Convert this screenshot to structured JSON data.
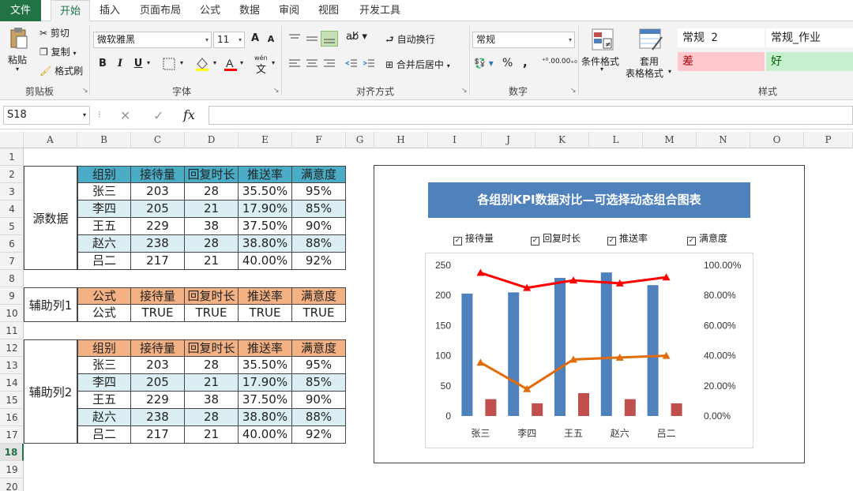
{
  "tabs": [
    "文件",
    "开始",
    "插入",
    "页面布局",
    "公式",
    "数据",
    "审阅",
    "视图",
    "开发工具"
  ],
  "ribbon": {
    "clipboard": {
      "paste": "粘贴",
      "cut": "剪切",
      "copy": "复制",
      "format_painter": "格式刷",
      "label": "剪贴板"
    },
    "font": {
      "name": "微软雅黑",
      "size": "11",
      "bold": "B",
      "italic": "I",
      "underline": "U",
      "label": "字体",
      "grow": "A",
      "shrink": "A",
      "wen": "wén",
      "wen_char": "文"
    },
    "align": {
      "wrap": "自动换行",
      "merge": "合并后居中",
      "label": "对齐方式"
    },
    "number": {
      "format": "常规",
      "percent": "%",
      "comma": ",",
      "inc": "⁺⁰.00",
      "dec": ".00₊₀",
      "label": "数字"
    },
    "styles": {
      "cond": "条件格式",
      "table_fmt_1": "套用",
      "table_fmt_2": "表格格式",
      "normal2": "常规 2",
      "normal_work": "常规_作业",
      "bad": "差",
      "good": "好",
      "label": "样式"
    }
  },
  "formula_bar": {
    "name_box": "S18",
    "fx": "fx",
    "cancel": "✕",
    "enter": "✓",
    "value": ""
  },
  "columns": [
    "A",
    "B",
    "C",
    "D",
    "E",
    "F",
    "G",
    "H",
    "I",
    "J",
    "K",
    "L",
    "M",
    "N",
    "O",
    "P"
  ],
  "rows": [
    "1",
    "2",
    "3",
    "4",
    "5",
    "6",
    "7",
    "8",
    "9",
    "10",
    "11",
    "12",
    "13",
    "14",
    "15",
    "16",
    "17",
    "18",
    "19",
    "20"
  ],
  "selected_row": "18",
  "blocks": {
    "source": {
      "label": "源数据",
      "header": [
        "组别",
        "接待量",
        "回复时长",
        "推送率",
        "满意度"
      ],
      "rows": [
        [
          "张三",
          "203",
          "28",
          "35.50%",
          "95%"
        ],
        [
          "李四",
          "205",
          "21",
          "17.90%",
          "85%"
        ],
        [
          "王五",
          "229",
          "38",
          "37.50%",
          "90%"
        ],
        [
          "赵六",
          "238",
          "28",
          "38.80%",
          "88%"
        ],
        [
          "吕二",
          "217",
          "21",
          "40.00%",
          "92%"
        ]
      ]
    },
    "helper1": {
      "label": "辅助列1",
      "header": [
        "公式",
        "接待量",
        "回复时长",
        "推送率",
        "满意度"
      ],
      "rows": [
        [
          "公式",
          "TRUE",
          "TRUE",
          "TRUE",
          "TRUE"
        ]
      ]
    },
    "helper2": {
      "label": "辅助列2",
      "header": [
        "组别",
        "接待量",
        "回复时长",
        "推送率",
        "满意度"
      ],
      "rows": [
        [
          "张三",
          "203",
          "28",
          "35.50%",
          "95%"
        ],
        [
          "李四",
          "205",
          "21",
          "17.90%",
          "85%"
        ],
        [
          "王五",
          "229",
          "38",
          "37.50%",
          "90%"
        ],
        [
          "赵六",
          "238",
          "28",
          "38.80%",
          "88%"
        ],
        [
          "吕二",
          "217",
          "21",
          "40.00%",
          "92%"
        ]
      ]
    }
  },
  "checkboxes": [
    {
      "label": "接待量",
      "checked": true
    },
    {
      "label": "回复时长",
      "checked": true
    },
    {
      "label": "推送率",
      "checked": true
    },
    {
      "label": "满意度",
      "checked": true
    }
  ],
  "colors": {
    "bar1": "#4f81bd",
    "bar2": "#c0504d",
    "line1": "#e26b0a",
    "line2": "#ff0000",
    "accent": "#217346",
    "title_bg": "#4f81bd"
  },
  "chart_data": {
    "type": "bar",
    "title": "各组别KPI数据对比—可选择动态组合图表",
    "categories": [
      "张三",
      "李四",
      "王五",
      "赵六",
      "吕二"
    ],
    "series": [
      {
        "name": "接待量",
        "type": "bar",
        "axis": "left",
        "values": [
          203,
          205,
          229,
          238,
          217
        ]
      },
      {
        "name": "回复时长",
        "type": "bar",
        "axis": "left",
        "values": [
          28,
          21,
          38,
          28,
          21
        ]
      },
      {
        "name": "推送率",
        "type": "line",
        "axis": "right",
        "values": [
          0.355,
          0.179,
          0.375,
          0.388,
          0.4
        ]
      },
      {
        "name": "满意度",
        "type": "line",
        "axis": "right",
        "values": [
          0.95,
          0.85,
          0.9,
          0.88,
          0.92
        ]
      }
    ],
    "ylim": [
      0,
      250
    ],
    "y_ticks": [
      "250",
      "200",
      "150",
      "100",
      "50",
      "0"
    ],
    "y2lim": [
      0,
      1
    ],
    "y2_ticks": [
      "100.00%",
      "80.00%",
      "60.00%",
      "40.00%",
      "20.00%",
      "0.00%"
    ],
    "grid": false
  }
}
